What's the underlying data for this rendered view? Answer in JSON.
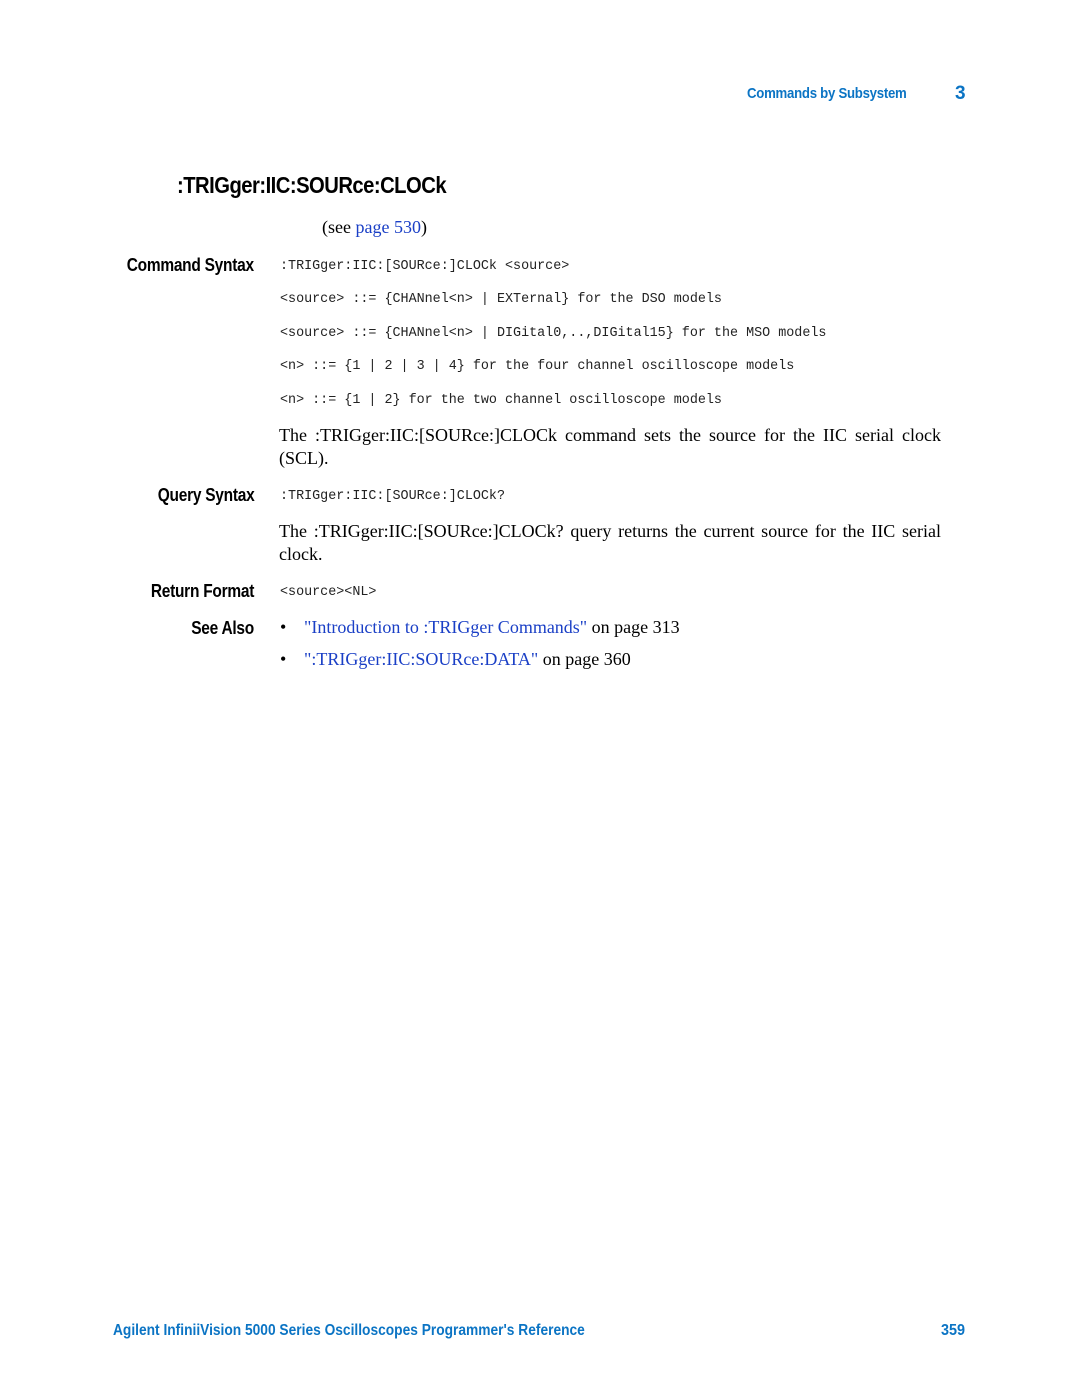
{
  "header": {
    "section": "Commands by Subsystem",
    "chapter": "3"
  },
  "title": ":TRIGger:IIC:SOURce:CLOCk",
  "see_page": {
    "prefix": "(see ",
    "link_text": "page 530",
    "suffix": ")"
  },
  "command_syntax": {
    "label": "Command Syntax",
    "lines": [
      ":TRIGger:IIC:[SOURce:]CLOCk <source>",
      "<source> ::= {CHANnel<n> | EXTernal} for the DSO models",
      "<source> ::= {CHANnel<n> | DIGital0,..,DIGital15} for the MSO models",
      "<n> ::= {1 | 2 | 3 | 4} for the four channel oscilloscope models",
      "<n> ::= {1 | 2} for the two channel oscilloscope models"
    ],
    "description": "The :TRIGger:IIC:[SOURce:]CLOCk command sets the source for the IIC serial clock (SCL)."
  },
  "query_syntax": {
    "label": "Query Syntax",
    "line": ":TRIGger:IIC:[SOURce:]CLOCk?",
    "description": "The :TRIGger:IIC:[SOURce:]CLOCk? query returns the current source for the IIC serial clock."
  },
  "return_format": {
    "label": "Return Format",
    "line": "<source><NL>"
  },
  "see_also": {
    "label": "See Also",
    "items": [
      {
        "bullet": "•",
        "link": "\"Introduction to :TRIGger Commands\"",
        "suffix": " on page 313"
      },
      {
        "bullet": "•",
        "link": "\":TRIGger:IIC:SOURce:DATA\"",
        "suffix": " on page 360"
      }
    ]
  },
  "footer": {
    "title": "Agilent InfiniiVision 5000 Series Oscilloscopes Programmer's Reference",
    "page_number": "359"
  },
  "colors": {
    "header_blue": "#0b74c4",
    "link_blue": "#1a3fc6"
  }
}
